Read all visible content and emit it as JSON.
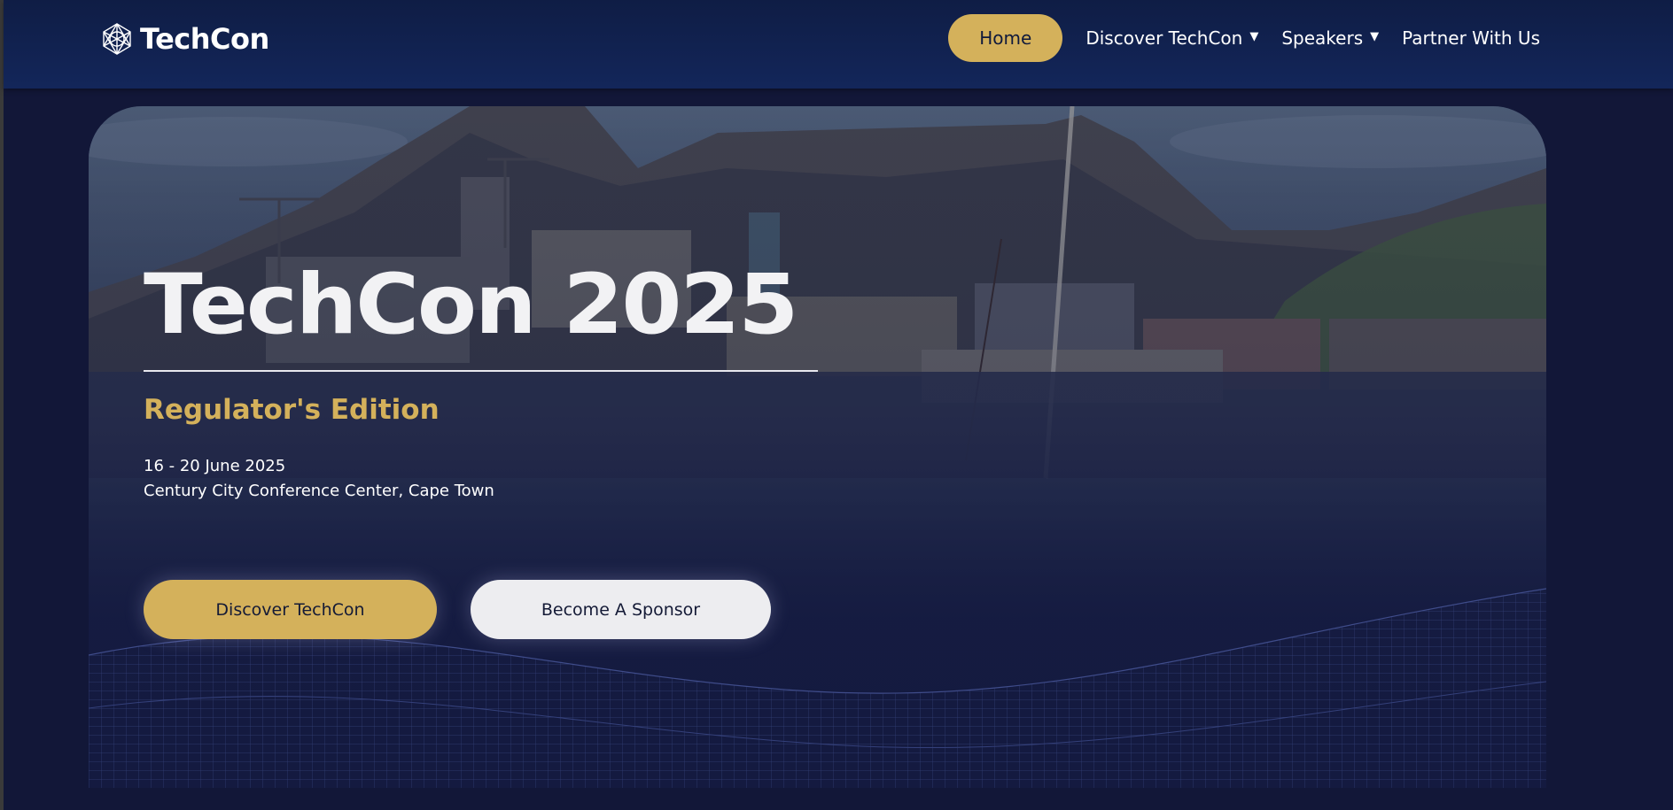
{
  "brand": {
    "name": "TechCon"
  },
  "nav": {
    "items": [
      {
        "label": "Home"
      },
      {
        "label": "Discover TechCon",
        "caret": "▼"
      },
      {
        "label": "Speakers",
        "caret": "▼"
      },
      {
        "label": "Partner With Us"
      }
    ]
  },
  "hero": {
    "title": "TechCon 2025",
    "subtitle": "Regulator's Edition",
    "date": "16 - 20 June 2025",
    "venue": "Century City Conference Center, Cape Town",
    "primary_button": "Discover TechCon",
    "secondary_button": "Become A Sponsor"
  },
  "colors": {
    "accent": "#d4b15b",
    "nav_bg": "#13265a",
    "page_bg": "#121738",
    "text": "#ffffff"
  },
  "icons": {
    "logo": "network-sphere-icon",
    "dropdown": "caret-down-icon"
  }
}
